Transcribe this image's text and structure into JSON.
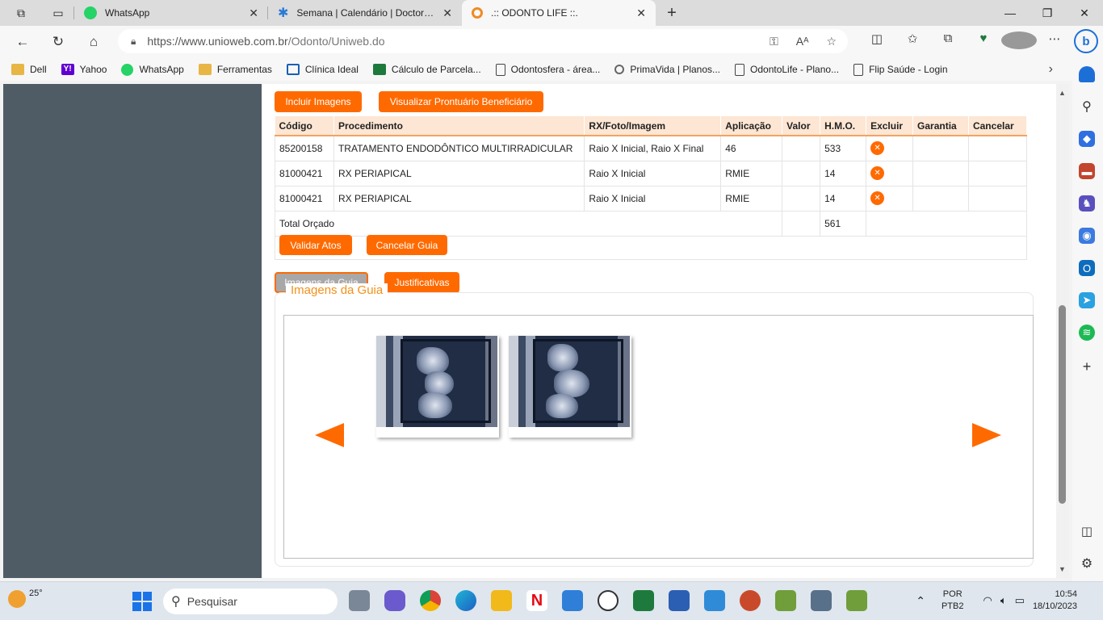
{
  "browser": {
    "tabs": [
      {
        "title": "WhatsApp",
        "active": false
      },
      {
        "title": "Semana | Calendário | Doctoralia",
        "active": false
      },
      {
        "title": ".:: ODONTO LIFE ::.",
        "active": true
      }
    ],
    "url_host": "https://www.unioweb.com.br",
    "url_path": "/Odonto/Uniweb.do",
    "bookmarks": [
      "Dell",
      "Yahoo",
      "WhatsApp",
      "Ferramentas",
      "Clínica Ideal",
      "Cálculo de Parcela...",
      "Odontosfera - área...",
      "PrimaVida | Planos...",
      "OdontoLife - Plano...",
      "Flip Saúde - Login"
    ]
  },
  "actions": {
    "incluir_imagens": "Incluir Imagens",
    "visualizar_prontuario": "Visualizar Prontuário Beneficiário",
    "validar_atos": "Validar Atos",
    "cancelar_guia": "Cancelar Guia"
  },
  "table": {
    "headers": [
      "Código",
      "Procedimento",
      "RX/Foto/Imagem",
      "Aplicação",
      "Valor",
      "H.M.O.",
      "Excluir",
      "Garantia",
      "Cancelar"
    ],
    "rows": [
      {
        "codigo": "85200158",
        "procedimento": "TRATAMENTO ENDODÔNTICO MULTIRRADICULAR",
        "rx": "Raio X Inicial, Raio X Final",
        "aplicacao": "46",
        "valor": "",
        "hmo": "533"
      },
      {
        "codigo": "81000421",
        "procedimento": "RX PERIAPICAL",
        "rx": "Raio X Inicial",
        "aplicacao": "RMIE",
        "valor": "",
        "hmo": "14"
      },
      {
        "codigo": "81000421",
        "procedimento": "RX PERIAPICAL",
        "rx": "Raio X Inicial",
        "aplicacao": "RMIE",
        "valor": "",
        "hmo": "14"
      }
    ],
    "total_label": "Total Orçado",
    "total_hmo": "561"
  },
  "section_tabs": {
    "imagens": "Imagens da Guia",
    "justificativas": "Justificativas"
  },
  "gallery": {
    "legend": "Imagens da Guia"
  },
  "taskbar": {
    "temperature": "25°",
    "search_placeholder": "Pesquisar",
    "lang_top": "POR",
    "lang_bottom": "PTB2",
    "time": "10:54",
    "date": "18/10/2023"
  },
  "colors": {
    "accent": "#ff6a00",
    "sidebar": "#4f5c66",
    "legend": "#f39019"
  }
}
